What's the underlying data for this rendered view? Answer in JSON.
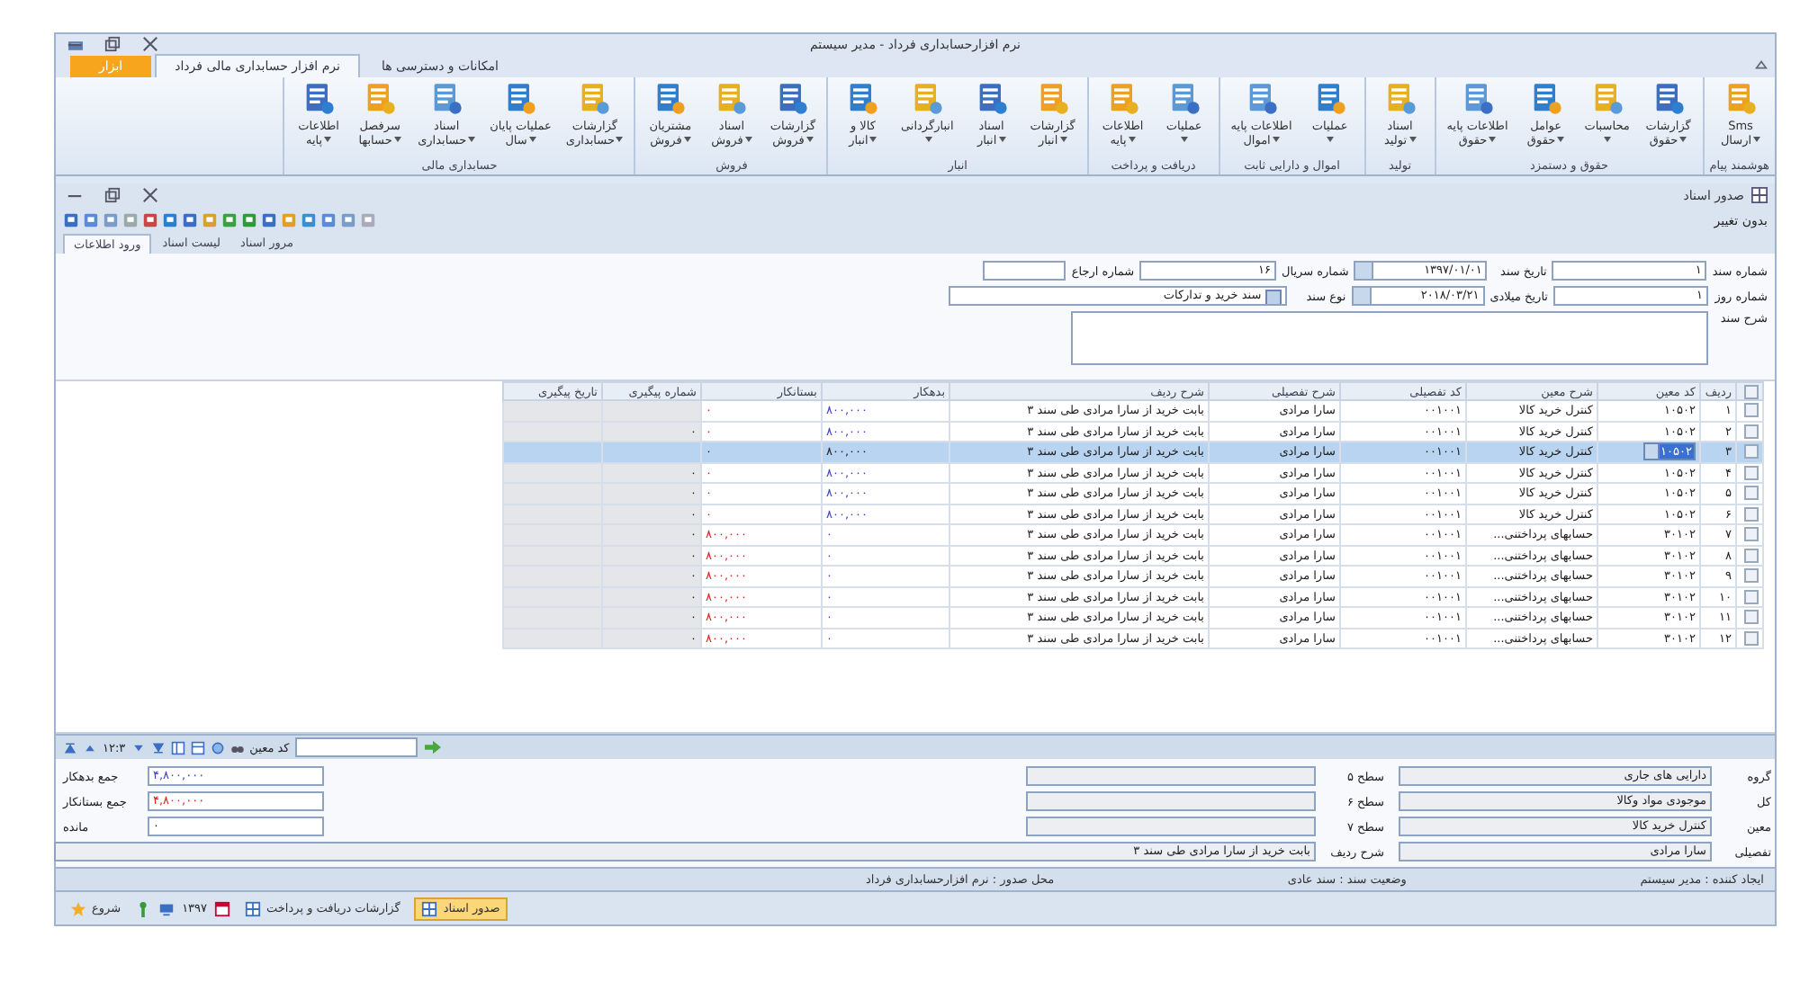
{
  "window": {
    "title": "نرم افزارحسابداری فرداد - مدیر سیستم"
  },
  "ribbon_tabs": [
    {
      "label": "امکانات و دسترسی ها",
      "kind": "normal",
      "selected": false
    },
    {
      "label": "نرم افزار حسابداری مالی فرداد",
      "kind": "normal",
      "selected": true
    },
    {
      "label": "ابزار",
      "kind": "contextual",
      "selected": false
    }
  ],
  "ribbon_groups": [
    {
      "label": "هوشمند پیام",
      "buttons": [
        {
          "line1": "Sms",
          "line2": "ارسال"
        }
      ]
    },
    {
      "label": "حقوق و دستمزد",
      "buttons": [
        {
          "line1": "گزارشات",
          "line2": "حقوق"
        },
        {
          "line1": "محاسبات"
        },
        {
          "line1": "عوامل",
          "line2": "حقوق"
        },
        {
          "line1": "اطلاعات پایه",
          "line2": "حقوق"
        }
      ]
    },
    {
      "label": "تولید",
      "buttons": [
        {
          "line1": "اسناد",
          "line2": "تولید"
        }
      ]
    },
    {
      "label": "اموال و دارایی ثابت",
      "buttons": [
        {
          "line1": "عملیات"
        },
        {
          "line1": "اطلاعات پایه",
          "line2": "اموال"
        }
      ]
    },
    {
      "label": "دریافت و پرداخت",
      "buttons": [
        {
          "line1": "عملیات"
        },
        {
          "line1": "اطلاعات",
          "line2": "پایه"
        }
      ]
    },
    {
      "label": "انبار",
      "buttons": [
        {
          "line1": "گزارشات",
          "line2": "انبار"
        },
        {
          "line1": "اسناد",
          "line2": "انبار"
        },
        {
          "line1": "انبارگردانی"
        },
        {
          "line1": "کالا و",
          "line2": "انبار"
        }
      ]
    },
    {
      "label": "فروش",
      "buttons": [
        {
          "line1": "گزارشات",
          "line2": "فروش"
        },
        {
          "line1": "اسناد",
          "line2": "فروش"
        },
        {
          "line1": "مشتریان",
          "line2": "فروش"
        }
      ]
    },
    {
      "label": "حسابداری مالی",
      "buttons": [
        {
          "line1": "گزارشات",
          "line2": "حسابداری"
        },
        {
          "line1": "عملیات پایان",
          "line2": "سال"
        },
        {
          "line1": "اسناد",
          "line2": "حسابداری"
        },
        {
          "line1": "سرفصل",
          "line2": "حسابها"
        },
        {
          "line1": "اطلاعات",
          "line2": "پایه"
        }
      ]
    }
  ],
  "document_window": {
    "title": "صدور اسناد",
    "status": "بدون تغییر"
  },
  "sub_tabs": [
    {
      "label": "مرور اسناد",
      "selected": false
    },
    {
      "label": "لیست اسناد",
      "selected": false
    },
    {
      "label": "ورود اطلاعات",
      "selected": true
    }
  ],
  "form": {
    "doc_number": {
      "label": "شماره سند",
      "value": "۱"
    },
    "doc_date": {
      "label": "تاریخ سند",
      "value": "۱۳۹۷/۰۱/۰۱"
    },
    "serial": {
      "label": "شماره سریال",
      "value": "۱۶"
    },
    "reference": {
      "label": "شماره ارجاع"
    },
    "day_number": {
      "label": "شماره روز",
      "value": "۱"
    },
    "gregorian_date": {
      "label": "تاریخ میلادی",
      "value": "۲۰۱۸/۰۳/۲۱"
    },
    "doc_type": {
      "label": "نوع سند",
      "value": "سند خرید و تدارکات"
    },
    "description": {
      "label": "شرح سند"
    }
  },
  "table": {
    "all_checked": false,
    "columns": [
      "ردیف",
      "کد معین",
      "شرح معین",
      "کد تفصیلی",
      "شرح تفصیلی",
      "شرح ردیف",
      "بدهکار",
      "بستانکار",
      "شماره پیگیری",
      "تاریخ پیگیری"
    ],
    "rows": [
      {
        "cells": [
          "۱",
          "۱۰۵۰۲",
          "کنترل خرید کالا",
          "۰۰۱۰۰۱",
          "سارا مرادی",
          "بابت خرید از  سارا مرادی طی سند ۳",
          "۸۰۰,۰۰۰",
          "۰",
          ""
        ],
        "selected": false
      },
      {
        "cells": [
          "۲",
          "۱۰۵۰۲",
          "کنترل خرید کالا",
          "۰۰۱۰۰۱",
          "سارا مرادی",
          "بابت خرید از  سارا مرادی طی سند ۳",
          "۸۰۰,۰۰۰",
          "۰",
          "۰"
        ],
        "selected": false
      },
      {
        "cells": [
          "۳",
          "۱۰۵۰۲",
          "کنترل خرید کالا",
          "۰۰۱۰۰۱",
          "سارا مرادی",
          "بابت خرید از  سارا مرادی طی سند ۳",
          "۸۰۰,۰۰۰",
          "۰",
          ""
        ],
        "selected": true
      },
      {
        "cells": [
          "۴",
          "۱۰۵۰۲",
          "کنترل خرید کالا",
          "۰۰۱۰۰۱",
          "سارا مرادی",
          "بابت خرید از  سارا مرادی طی سند ۳",
          "۸۰۰,۰۰۰",
          "۰",
          "۰"
        ],
        "selected": false
      },
      {
        "cells": [
          "۵",
          "۱۰۵۰۲",
          "کنترل خرید کالا",
          "۰۰۱۰۰۱",
          "سارا مرادی",
          "بابت خرید از  سارا مرادی طی سند ۳",
          "۸۰۰,۰۰۰",
          "۰",
          "۰"
        ],
        "selected": false
      },
      {
        "cells": [
          "۶",
          "۱۰۵۰۲",
          "کنترل خرید کالا",
          "۰۰۱۰۰۱",
          "سارا مرادی",
          "بابت خرید از  سارا مرادی طی سند ۳",
          "۸۰۰,۰۰۰",
          "۰",
          "۰"
        ],
        "selected": false
      },
      {
        "cells": [
          "۷",
          "۳۰۱۰۲",
          "حسابهای پرداختنی...",
          "۰۰۱۰۰۱",
          "سارا مرادی",
          "بابت خرید از  سارا مرادی طی سند ۳",
          "۰",
          "۸۰۰,۰۰۰",
          "۰"
        ],
        "selected": false
      },
      {
        "cells": [
          "۸",
          "۳۰۱۰۲",
          "حسابهای پرداختنی...",
          "۰۰۱۰۰۱",
          "سارا مرادی",
          "بابت خرید از  سارا مرادی طی سند ۳",
          "۰",
          "۸۰۰,۰۰۰",
          "۰"
        ],
        "selected": false
      },
      {
        "cells": [
          "۹",
          "۳۰۱۰۲",
          "حسابهای پرداختنی...",
          "۰۰۱۰۰۱",
          "سارا مرادی",
          "بابت خرید از  سارا مرادی طی سند ۳",
          "۰",
          "۸۰۰,۰۰۰",
          "۰"
        ],
        "selected": false
      },
      {
        "cells": [
          "۱۰",
          "۳۰۱۰۲",
          "حسابهای پرداختنی...",
          "۰۰۱۰۰۱",
          "سارا مرادی",
          "بابت خرید از  سارا مرادی طی سند ۳",
          "۰",
          "۸۰۰,۰۰۰",
          "۰"
        ],
        "selected": false
      },
      {
        "cells": [
          "۱۱",
          "۳۰۱۰۲",
          "حسابهای پرداختنی...",
          "۰۰۱۰۰۱",
          "سارا مرادی",
          "بابت خرید از  سارا مرادی طی سند ۳",
          "۰",
          "۸۰۰,۰۰۰",
          "۰"
        ],
        "selected": false
      },
      {
        "cells": [
          "۱۲",
          "۳۰۱۰۲",
          "حسابهای پرداختنی...",
          "۰۰۱۰۰۱",
          "سارا مرادی",
          "بابت خرید از  سارا مرادی طی سند ۳",
          "۰",
          "۸۰۰,۰۰۰",
          "۰"
        ],
        "selected": false
      }
    ]
  },
  "navigator": {
    "position": "۱۲:۳",
    "search_label": "کد معین"
  },
  "account_levels": [
    {
      "label": "گروه",
      "value": "دارایی های جاری"
    },
    {
      "label": "کل",
      "value": "موجودی مواد وکالا"
    },
    {
      "label": "معین",
      "value": "کنترل خرید کالا"
    },
    {
      "label": "تفصیلی",
      "value": "سارا مرادی"
    }
  ],
  "levels": [
    {
      "label": "سطح ۵"
    },
    {
      "label": "سطح ۶"
    },
    {
      "label": "سطح ۷"
    }
  ],
  "row_description": {
    "label": "شرح ردیف",
    "value": "بابت خرید از  سارا مرادی طی سند ۳"
  },
  "totals": [
    {
      "label": "جمع بدهکار",
      "value": "۴,۸۰۰,۰۰۰",
      "kind": "debit"
    },
    {
      "label": "جمع بستانکار",
      "value": "۴,۸۰۰,۰۰۰",
      "kind": "credit"
    },
    {
      "label": "مانده",
      "value": "۰",
      "kind": "balance"
    }
  ],
  "status_bar": [
    "ایجاد کننده : مدیر سیستم",
    "وضعیت سند : سند عادی",
    "محل صدور : نرم افزارحسابداری فرداد"
  ],
  "taskbar": {
    "start": "شروع",
    "year": "۱۳۹۷",
    "windows": [
      {
        "label": "صدور اسناد",
        "selected": true
      },
      {
        "label": "گزارشات دریافت و پرداخت",
        "selected": false
      }
    ]
  }
}
